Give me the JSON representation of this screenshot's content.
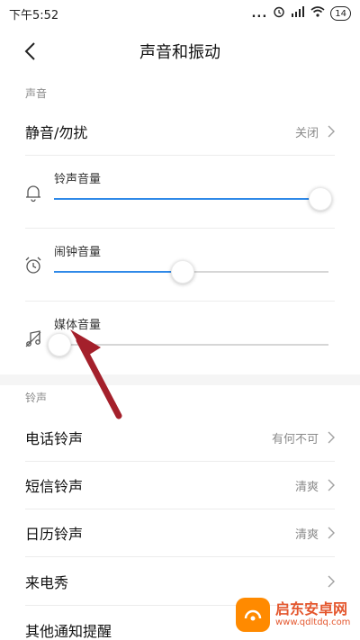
{
  "status_bar": {
    "time": "下午5:52",
    "battery": "14",
    "dots": "..."
  },
  "header": {
    "title": "声音和振动"
  },
  "sections": {
    "sound": {
      "label": "声音"
    },
    "ringtone": {
      "label": "铃声"
    }
  },
  "do_not_disturb": {
    "label": "静音/勿扰",
    "value": "关闭"
  },
  "volumes": [
    {
      "label": "铃声音量",
      "level": 0.97,
      "icon": "bell-icon"
    },
    {
      "label": "闹钟音量",
      "level": 0.47,
      "icon": "alarm-clock-icon"
    },
    {
      "label": "媒体音量",
      "level": 0.02,
      "icon": "music-note-icon"
    }
  ],
  "ringtones": [
    {
      "label": "电话铃声",
      "value": "有何不可"
    },
    {
      "label": "短信铃声",
      "value": "清爽"
    },
    {
      "label": "日历铃声",
      "value": "清爽"
    },
    {
      "label": "来电秀",
      "value": ""
    },
    {
      "label": "其他通知提醒",
      "value": ""
    }
  ],
  "watermark": {
    "title": "启东安卓网",
    "url": "www.qdltdq.com"
  },
  "colors": {
    "accent": "#2f89e8",
    "arrow": "#a4202b",
    "track": "#d6d6d6"
  }
}
